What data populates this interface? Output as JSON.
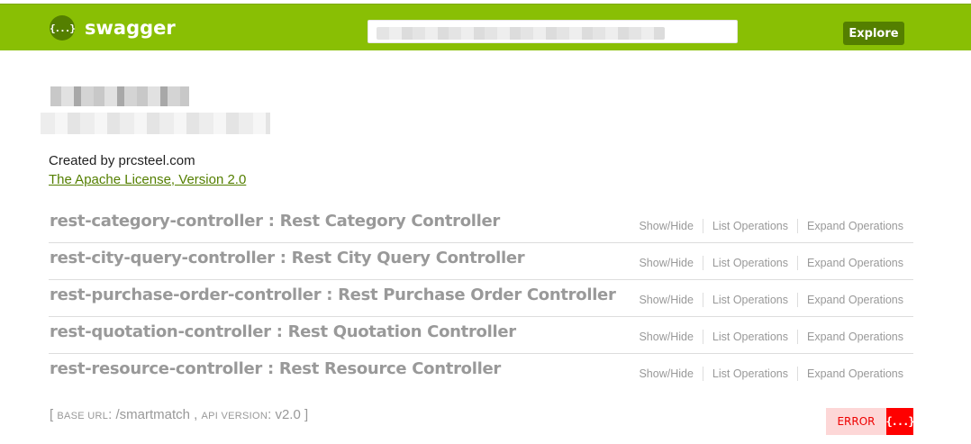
{
  "header": {
    "logo_glyph": "{...}",
    "logo_text": "swagger",
    "url_input_value": "",
    "explore_label": "Explore",
    "colors": {
      "bar": "#89bf04",
      "button": "#547f00"
    }
  },
  "info": {
    "created_by": "Created by prcsteel.com",
    "license": "The Apache License, Version 2.0"
  },
  "resources": [
    {
      "heading": "rest-category-controller : Rest Category Controller",
      "show_hide": "Show/Hide",
      "list_ops": "List Operations",
      "expand_ops": "Expand Operations"
    },
    {
      "heading": "rest-city-query-controller : Rest City Query Controller",
      "show_hide": "Show/Hide",
      "list_ops": "List Operations",
      "expand_ops": "Expand Operations"
    },
    {
      "heading": "rest-purchase-order-controller : Rest Purchase Order Controller",
      "show_hide": "Show/Hide",
      "list_ops": "List Operations",
      "expand_ops": "Expand Operations"
    },
    {
      "heading": "rest-quotation-controller : Rest Quotation Controller",
      "show_hide": "Show/Hide",
      "list_ops": "List Operations",
      "expand_ops": "Expand Operations"
    },
    {
      "heading": "rest-resource-controller : Rest Resource Controller",
      "show_hide": "Show/Hide",
      "list_ops": "List Operations",
      "expand_ops": "Expand Operations"
    }
  ],
  "footer": {
    "open_bracket": "[",
    "base_url_label": "base url",
    "base_url_value": ": /smartmatch ,",
    "api_version_label": "api version",
    "api_version_value": ": v2.0",
    "close_bracket": "]",
    "validator_text": "ERROR",
    "validator_glyph": "{...}"
  }
}
